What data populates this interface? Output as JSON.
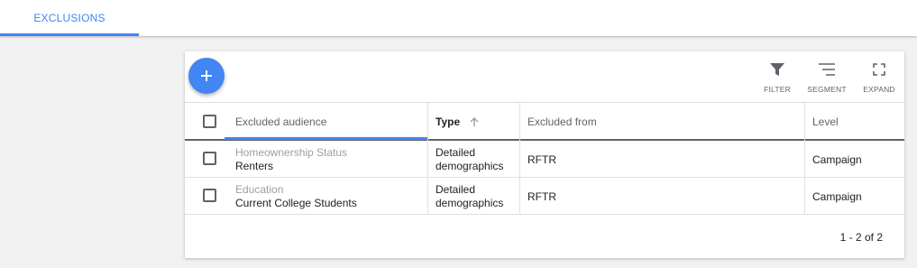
{
  "tabs": [
    {
      "label": "EXCLUSIONS",
      "active": true
    }
  ],
  "toolbar": {
    "add_icon": "plus-icon",
    "filter_label": "FILTER",
    "segment_label": "SEGMENT",
    "expand_label": "EXPAND"
  },
  "table": {
    "columns": [
      "Excluded audience",
      "Type",
      "Excluded from",
      "Level"
    ],
    "sorted_column": "Type",
    "sort_direction": "ascending",
    "rows": [
      {
        "audience_category": "Homeownership Status",
        "audience_name": "Renters",
        "type_line1": "Detailed",
        "type_line2": "demographics",
        "excluded_from": "RFTR",
        "level": "Campaign"
      },
      {
        "audience_category": "Education",
        "audience_name": "Current College Students",
        "type_line1": "Detailed",
        "type_line2": "demographics",
        "excluded_from": "RFTR",
        "level": "Campaign"
      }
    ]
  },
  "pagination": "1 - 2 of 2",
  "colors": {
    "accent": "#4285f4",
    "background": "#f1f1f1",
    "card": "#ffffff"
  }
}
